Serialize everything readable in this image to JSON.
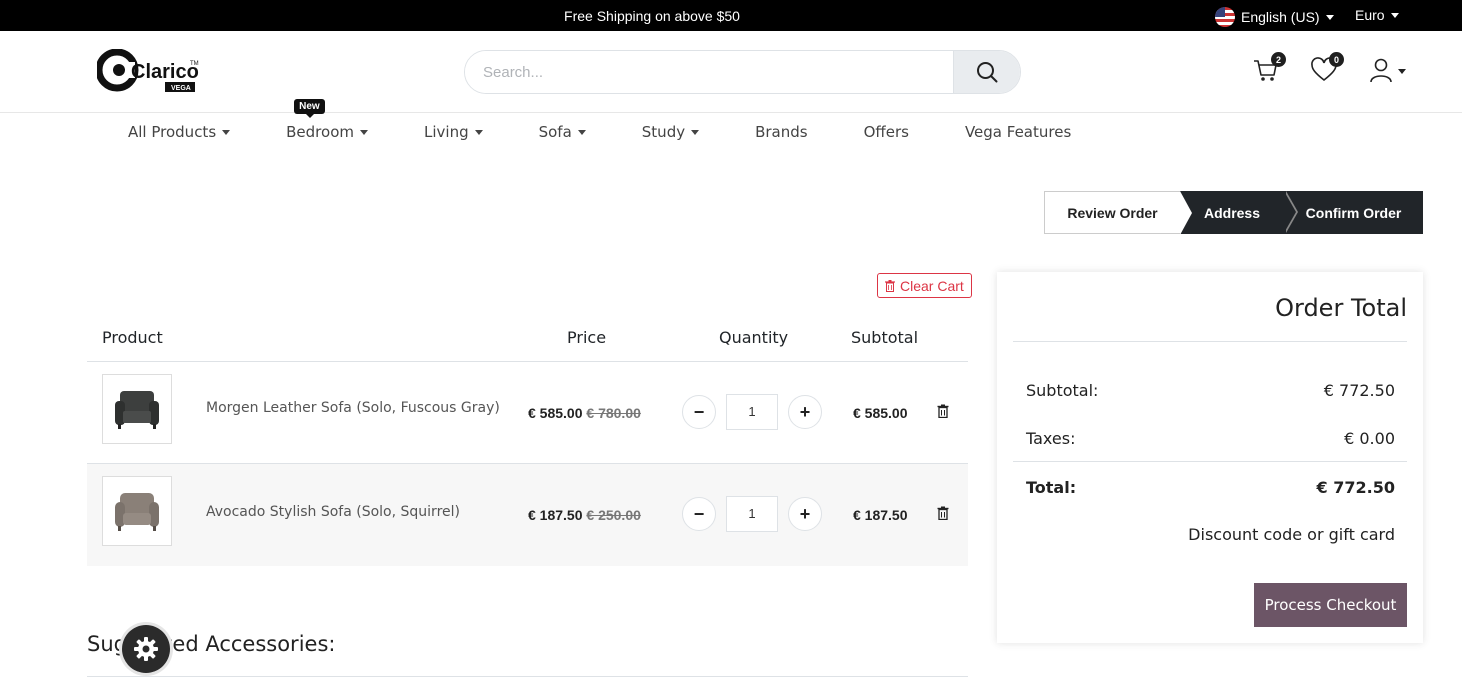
{
  "topbar": {
    "promo": "Free Shipping on above $50",
    "language": "English (US)",
    "currency": "Euro"
  },
  "header": {
    "logo_text": "Clarico",
    "logo_sub": "VEGA",
    "search_placeholder": "Search...",
    "cart_count": "2",
    "wishlist_count": "0"
  },
  "nav": {
    "items": [
      {
        "label": "All Products",
        "dropdown": true
      },
      {
        "label": "Bedroom",
        "dropdown": true,
        "tag": "New"
      },
      {
        "label": "Living",
        "dropdown": true
      },
      {
        "label": "Sofa",
        "dropdown": true
      },
      {
        "label": "Study",
        "dropdown": true
      },
      {
        "label": "Brands",
        "dropdown": false
      },
      {
        "label": "Offers",
        "dropdown": false
      },
      {
        "label": "Vega Features",
        "dropdown": false
      }
    ]
  },
  "steps": [
    "Review Order",
    "Address",
    "Confirm Order"
  ],
  "cart": {
    "clear_label": "Clear Cart",
    "headers": {
      "product": "Product",
      "price": "Price",
      "quantity": "Quantity",
      "subtotal": "Subtotal"
    },
    "rows": [
      {
        "name": "Morgen Leather Sofa (Solo, Fuscous Gray)",
        "price": "€ 585.00",
        "old_price": "€ 780.00",
        "qty": "1",
        "subtotal": "€ 585.00",
        "color": "#3d3f3e"
      },
      {
        "name": "Avocado Stylish Sofa (Solo, Squirrel)",
        "price": "€ 187.50",
        "old_price": "€ 250.00",
        "qty": "1",
        "subtotal": "€ 187.50",
        "color": "#8a8078"
      }
    ]
  },
  "suggested": {
    "title": "Suggested Accessories:"
  },
  "order_total": {
    "title": "Order Total",
    "subtotal_label": "Subtotal:",
    "subtotal_value": "€ 772.50",
    "taxes_label": "Taxes:",
    "taxes_value": "€ 0.00",
    "total_label": "Total:",
    "total_value": "€ 772.50",
    "discount_label": "Discount code or gift card",
    "checkout_label": "Process Checkout"
  },
  "colors": {
    "checkout": "#6c5566",
    "steps_active": "#212529",
    "clear_cart": "#dc3545"
  }
}
